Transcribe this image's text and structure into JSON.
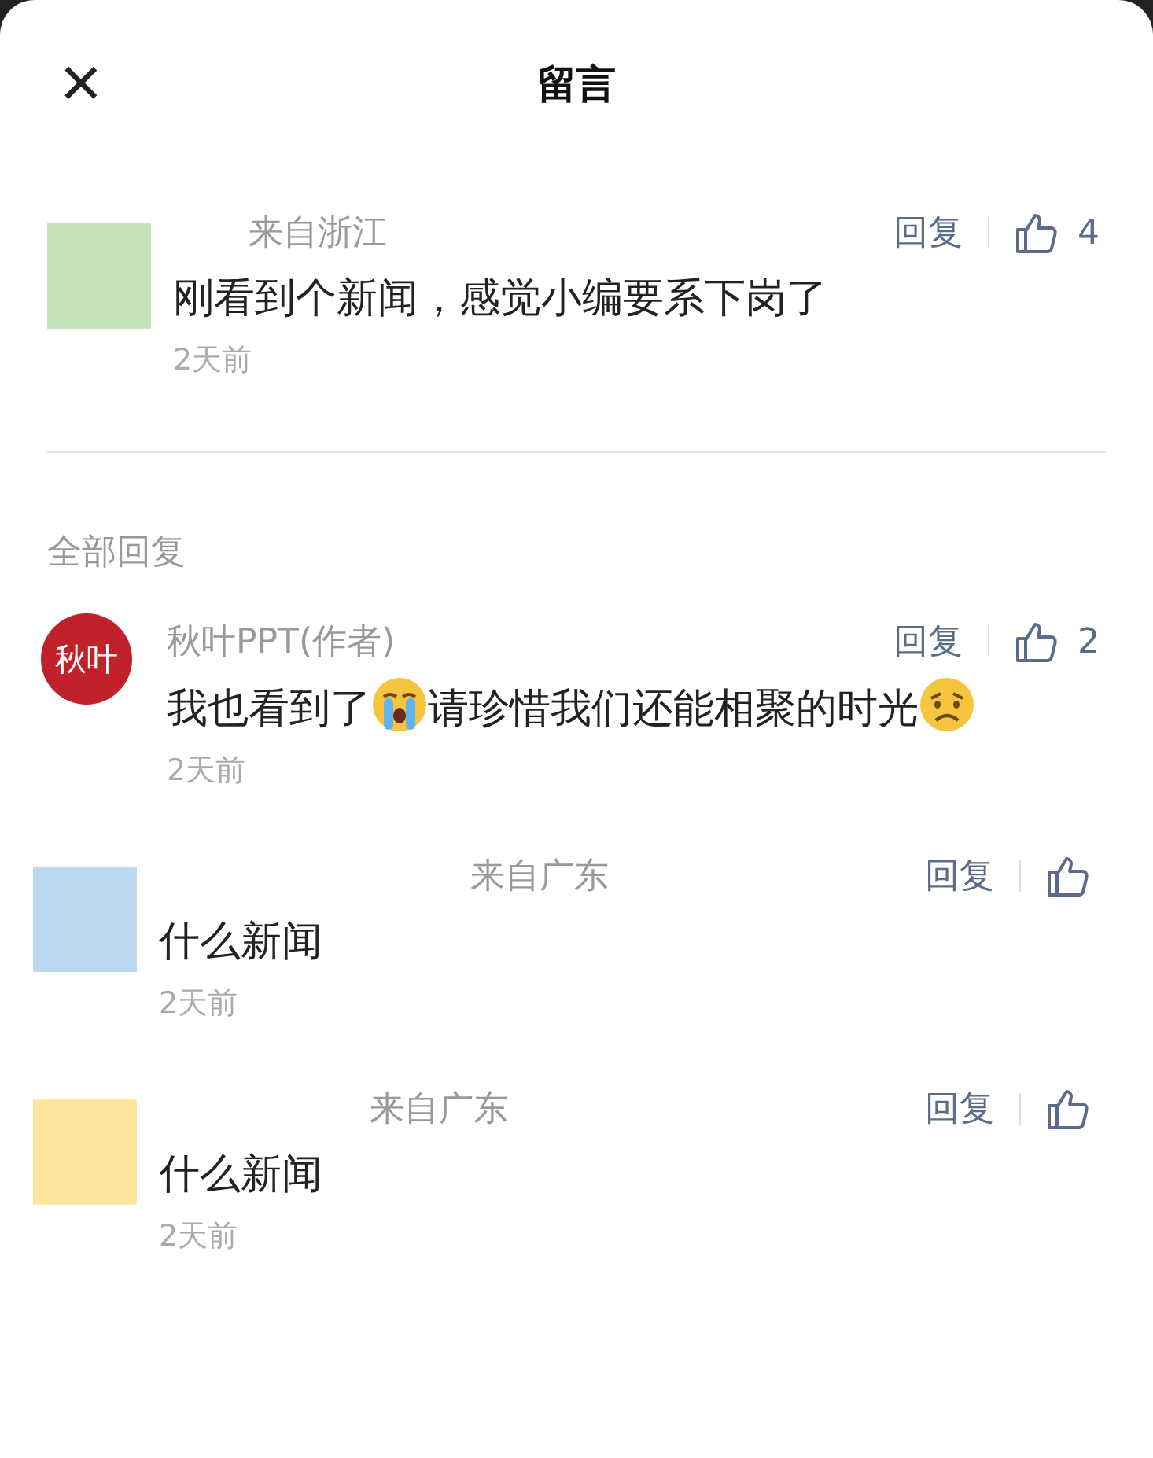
{
  "header": {
    "close": "×",
    "title": "留言"
  },
  "featured": {
    "avatar": {
      "kind": "square",
      "color": "#c5e3b8"
    },
    "location": "来自浙江",
    "parts": [
      {
        "kind": "text",
        "text": "刚看到个新闻，感觉小编要系下岗了"
      }
    ],
    "time": "2天前",
    "reply": "回复",
    "likes": "4"
  },
  "section_title": "全部回复",
  "replies": [
    {
      "avatar": {
        "kind": "logo",
        "text": "秋叶"
      },
      "author": "秋叶PPT(作者)",
      "parts": [
        {
          "kind": "text",
          "text": "我也看到了"
        },
        {
          "kind": "cry"
        },
        {
          "kind": "text",
          "text": "请珍惜我们还能相聚的时光"
        },
        {
          "kind": "sad"
        }
      ],
      "time": "2天前",
      "reply": "回复",
      "likes": "2"
    },
    {
      "avatar": {
        "kind": "square",
        "color": "#bcd8ef"
      },
      "location": "来自广东",
      "parts": [
        {
          "kind": "text",
          "text": "什么新闻"
        }
      ],
      "time": "2天前",
      "reply": "回复"
    },
    {
      "avatar": {
        "kind": "square",
        "color": "#fde49c"
      },
      "location": "来自广东",
      "parts": [
        {
          "kind": "text",
          "text": "什么新闻"
        }
      ],
      "time": "2天前",
      "reply": "回复"
    }
  ]
}
